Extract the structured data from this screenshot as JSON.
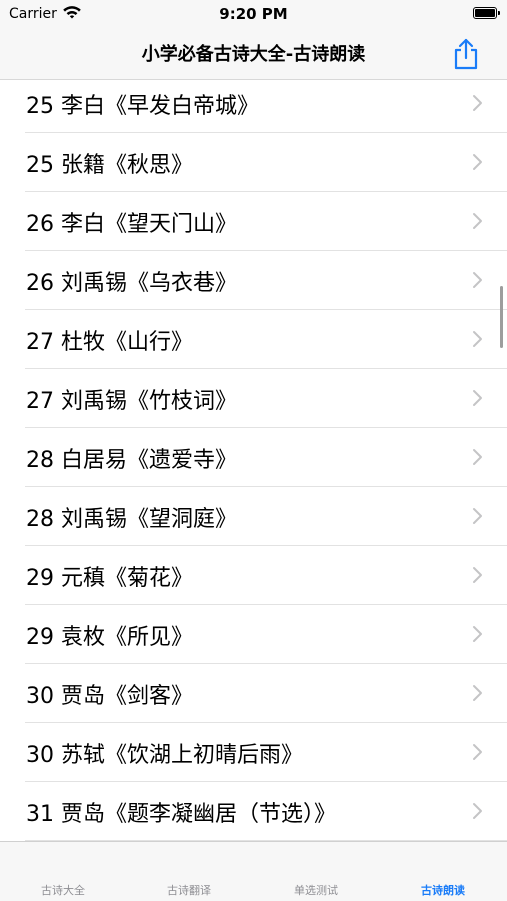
{
  "status_bar": {
    "carrier": "Carrier",
    "time": "9:20 PM"
  },
  "nav": {
    "title": "小学必备古诗大全-古诗朗读"
  },
  "colors": {
    "accent": "#1a7cf8",
    "tab_inactive": "#8e8e93",
    "chevron": "#c4c4c6"
  },
  "poems": [
    "25 李白《早发白帝城》",
    "25 张籍《秋思》",
    "26 李白《望天门山》",
    "26 刘禹锡《乌衣巷》",
    "27 杜牧《山行》",
    "27 刘禹锡《竹枝词》",
    "28 白居易《遗爱寺》",
    "28 刘禹锡《望洞庭》",
    "29 元稹《菊花》",
    "29 袁枚《所见》",
    "30 贾岛《剑客》",
    "30 苏轼《饮湖上初晴后雨》",
    "31 贾岛《题李凝幽居（节选）》"
  ],
  "tabs": [
    {
      "label": "古诗大全"
    },
    {
      "label": "古诗翻译"
    },
    {
      "label": "单选测试"
    },
    {
      "label": "古诗朗读"
    }
  ]
}
